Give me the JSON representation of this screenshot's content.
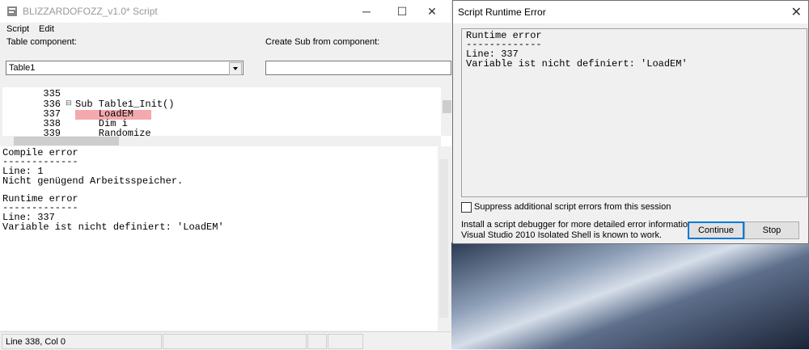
{
  "script_window": {
    "title": "BLIZZARDOFOZZ_v1.0* Script",
    "menu": [
      "Script",
      "Edit"
    ],
    "table_component_label": "Table component:",
    "create_sub_label": "Create Sub from component:",
    "table_combo_value": "Table1",
    "create_sub_value": ""
  },
  "editor": {
    "line_numbers": [
      "335",
      "336",
      "337",
      "338",
      "339"
    ],
    "code_lines": [
      "",
      "Sub Table1_Init()",
      "    LoadEM",
      "    Dim i",
      "    Randomize"
    ],
    "fold_marker": "⊟"
  },
  "output": {
    "lines": [
      "Compile error",
      "-------------",
      "Line: 1",
      "Nicht genügend Arbeitsspeicher.",
      "",
      "Runtime error",
      "-------------",
      "Line: 337",
      "Variable ist nicht definiert: 'LoadEM'"
    ]
  },
  "status": {
    "text": "Line 338, Col 0"
  },
  "dialog": {
    "title": "Script Runtime Error",
    "text_lines": [
      "Runtime error",
      "-------------",
      "Line: 337",
      "Variable ist nicht definiert: 'LoadEM'"
    ],
    "suppress_label": "Suppress additional script errors from this session",
    "info_line1": "Install a script debugger for more detailed error information.",
    "info_line2": "Visual Studio 2010 Isolated Shell is known to work.",
    "continue_label": "Continue",
    "stop_label": "Stop"
  }
}
